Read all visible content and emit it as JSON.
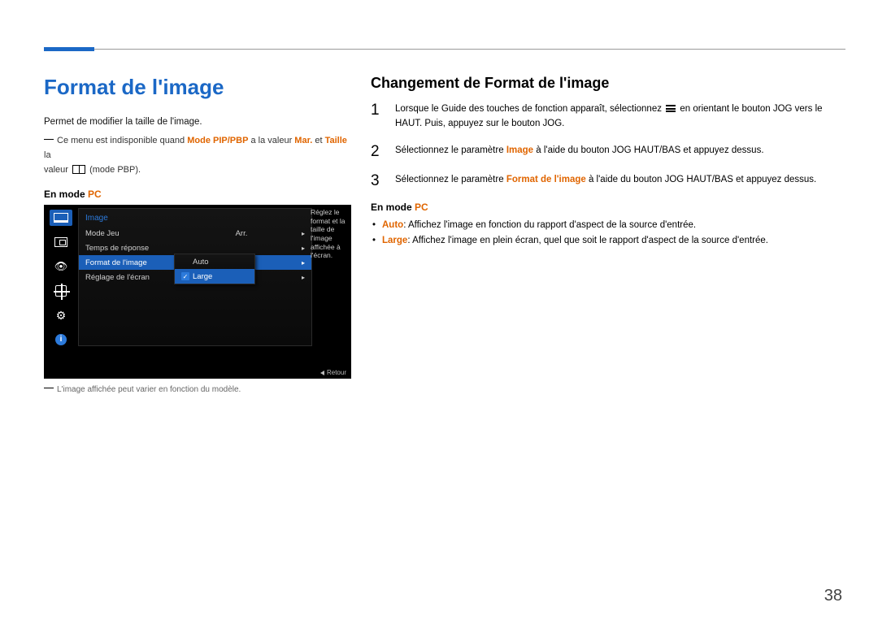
{
  "page_number": "38",
  "left": {
    "title": "Format de l'image",
    "intro": "Permet de modifier la taille de l'image.",
    "footnote_pre": "Ce menu est indisponible quand ",
    "footnote_mode": "Mode PIP/PBP",
    "footnote_mid": " a la valeur ",
    "footnote_mar": "Mar.",
    "footnote_et": " et ",
    "footnote_taille": "Taille",
    "footnote_la": " la",
    "footnote_valeur": "valeur ",
    "footnote_pbp": " (mode PBP).",
    "mode_label": "En mode ",
    "mode_pc": "PC",
    "note": "L'image affichée peut varier en fonction du modèle."
  },
  "osd": {
    "title": "Image",
    "rows": {
      "mode_jeu": "Mode Jeu",
      "mode_jeu_val": "Arr.",
      "temps": "Temps de réponse",
      "format": "Format de l'image",
      "format_val": "Auto",
      "reglage": "Réglage de l'écran"
    },
    "sub": {
      "auto": "Auto",
      "large": "Large"
    },
    "desc": "Réglez le format et la taille de l'image affichée à l'écran.",
    "return": "Retour"
  },
  "right": {
    "title": "Changement de Format de l'image",
    "step1_a": "Lorsque le Guide des touches de fonction apparaît, sélectionnez ",
    "step1_b": " en orientant le bouton JOG vers le HAUT. Puis, appuyez sur le bouton JOG.",
    "step2_a": "Sélectionnez le paramètre ",
    "step2_b": "Image",
    "step2_c": " à l'aide du bouton JOG HAUT/BAS et appuyez dessus.",
    "step3_a": "Sélectionnez le paramètre ",
    "step3_b": "Format de l'image",
    "step3_c": " à l'aide du bouton JOG HAUT/BAS et appuyez dessus.",
    "mode_label": "En mode ",
    "mode_pc": "PC",
    "bullet1_a": "Auto",
    "bullet1_b": ": Affichez l'image en fonction du rapport d'aspect de la source d'entrée.",
    "bullet2_a": "Large",
    "bullet2_b": ": Affichez l'image en plein écran, quel que soit le rapport d'aspect de la source d'entrée."
  }
}
